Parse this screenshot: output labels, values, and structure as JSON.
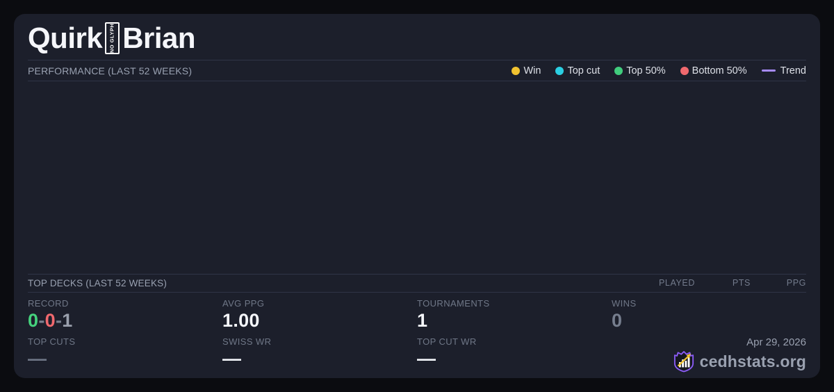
{
  "player": {
    "first_name": "Quirk",
    "missing_glyph_label": "NO GLYPH",
    "last_name": "Brian"
  },
  "performance": {
    "title": "PERFORMANCE (LAST 52 WEEKS)",
    "legend": [
      {
        "label": "Win",
        "color": "#f2c330",
        "marker": "dot"
      },
      {
        "label": "Top cut",
        "color": "#2bcfe2",
        "marker": "dot"
      },
      {
        "label": "Top 50%",
        "color": "#41cd7d",
        "marker": "dot"
      },
      {
        "label": "Bottom 50%",
        "color": "#f0696e",
        "marker": "dot"
      },
      {
        "label": "Trend",
        "color": "#a78bfa",
        "marker": "line"
      }
    ],
    "chart_points": []
  },
  "top_decks": {
    "title": "TOP DECKS (LAST 52 WEEKS)",
    "columns": [
      "PLAYED",
      "PTS",
      "PPG"
    ],
    "rows": []
  },
  "stats": {
    "record": {
      "label": "RECORD",
      "wins": "0",
      "losses": "0",
      "draws": "1",
      "separator": "-"
    },
    "avg_ppg": {
      "label": "AVG PPG",
      "value": "1.00"
    },
    "tournaments": {
      "label": "TOURNAMENTS",
      "value": "1"
    },
    "wins": {
      "label": "WINS",
      "value": "0"
    },
    "top_cuts": {
      "label": "TOP CUTS",
      "value": "—"
    },
    "swiss_wr": {
      "label": "SWISS WR",
      "value": "—"
    },
    "top_cut_wr": {
      "label": "TOP CUT WR",
      "value": "—"
    }
  },
  "footer": {
    "date": "Apr 29, 2026",
    "brand": "cedhstats.org"
  },
  "colors": {
    "page_background": "#0b0c10",
    "card_background": "#1c1f2b",
    "divider": "#2f3547",
    "win_yellow": "#f2c330",
    "top_cut_cyan": "#2bcfe2",
    "top50_green": "#41cd7d",
    "bottom50_red": "#f0696e",
    "trend_purple": "#a78bfa",
    "value_white": "#f4f6fa",
    "value_muted_gray": "#767e8e",
    "label_gray": "#6f7787",
    "brand_purple": "#8b5cf6",
    "brand_gold": "#f2c330"
  }
}
